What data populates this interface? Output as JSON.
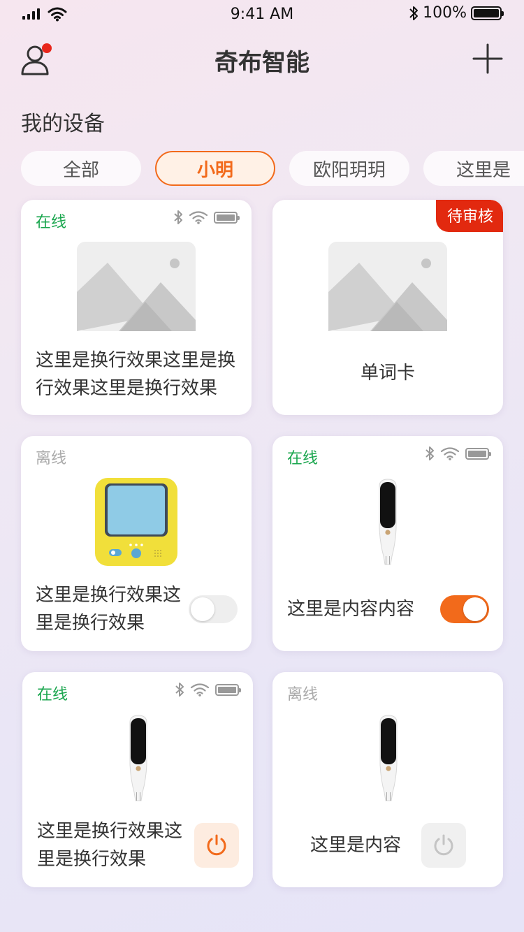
{
  "status_bar": {
    "time": "9:41 AM",
    "battery": "100%"
  },
  "header": {
    "title": "奇布智能"
  },
  "section": {
    "title": "我的设备"
  },
  "tabs": [
    {
      "label": "全部"
    },
    {
      "label": "小明"
    },
    {
      "label": "欧阳玥玥"
    },
    {
      "label": "这里是"
    }
  ],
  "devices": [
    {
      "status": "在线",
      "name": "这里是换行效果这里是换行效果这里是换行效果",
      "image": "placeholder-image"
    },
    {
      "badge": "待审核",
      "name": "单词卡",
      "image": "placeholder-image"
    },
    {
      "status": "离线",
      "name": "这里是换行效果这里是换行效果",
      "image": "yellow-device",
      "toggle": "off"
    },
    {
      "status": "在线",
      "name": "这里是内容内容",
      "image": "reading-pen",
      "toggle": "on"
    },
    {
      "status": "在线",
      "name": "这里是换行效果这里是换行效果",
      "image": "reading-pen",
      "power": "on"
    },
    {
      "status": "离线",
      "name": "这里是内容",
      "image": "reading-pen",
      "power": "off"
    }
  ],
  "colors": {
    "accent": "#f26a1b",
    "online": "#1aa64e",
    "offline": "#aaaaaa",
    "badge": "#e2290f"
  }
}
